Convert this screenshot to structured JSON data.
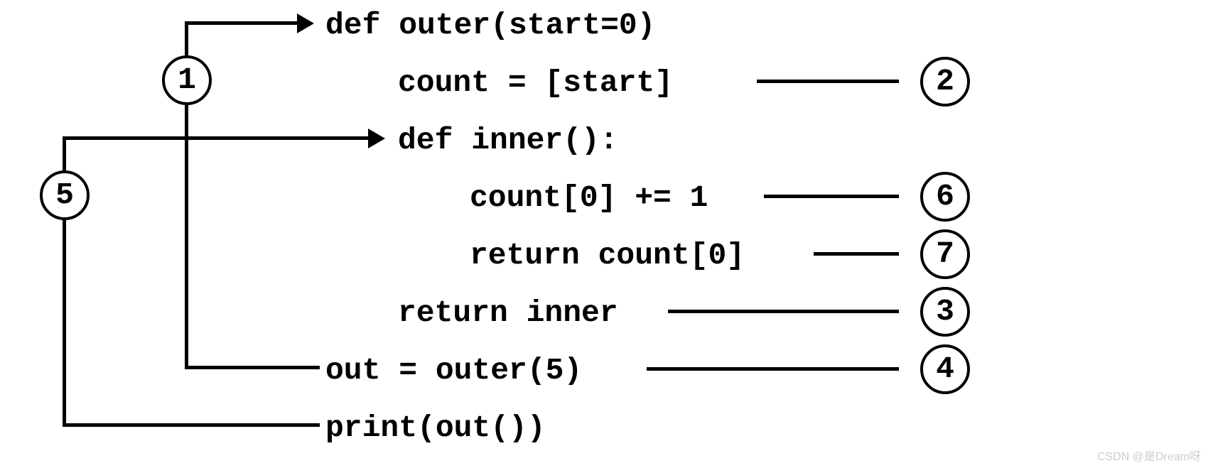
{
  "code": {
    "line1": "def outer(start=0)",
    "line2": "count = [start]",
    "line3": "def inner():",
    "line4": "count[0] += 1",
    "line5": "return count[0]",
    "line6": "return inner",
    "line7": "out = outer(5)",
    "line8": "print(out())"
  },
  "steps": {
    "s1": "1",
    "s2": "2",
    "s3": "3",
    "s4": "4",
    "s5": "5",
    "s6": "6",
    "s7": "7"
  },
  "watermark": "CSDN @是Dream呀"
}
